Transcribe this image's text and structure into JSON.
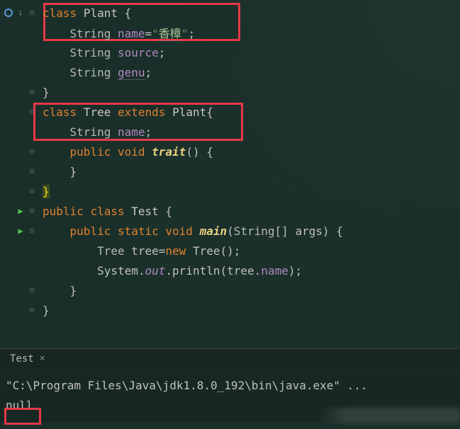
{
  "editor": {
    "plantClass": {
      "kw_class": "class",
      "name": "Plant",
      "lbrace": "{",
      "field1_type": "String",
      "field1_name": "name",
      "field1_eq": "=",
      "field1_quote1": "\"",
      "field1_val": "香樟",
      "field1_quote2": "\"",
      "field1_semi": ";",
      "field2_type": "String",
      "field2_name": "source",
      "field2_semi": ";",
      "field3_type": "String",
      "field3_name": "genu",
      "field3_semi": ";",
      "rbrace": "}"
    },
    "treeClass": {
      "kw_class": "class",
      "name": "Tree",
      "kw_extends": "extends",
      "super": "Plant",
      "lbrace": "{",
      "field1_type": "String",
      "field1_name": "name",
      "field1_semi": ";",
      "kw_public": "public",
      "kw_void": "void",
      "method": "trait",
      "parens": "()",
      "mlbrace": "{",
      "mrbrace": "}",
      "rbrace": "}"
    },
    "testClass": {
      "kw_public": "public",
      "kw_class": "class",
      "name": "Test",
      "lbrace": "{",
      "main_public": "public",
      "main_static": "static",
      "main_void": "void",
      "main_name": "main",
      "main_params_open": "(",
      "main_params_type": "String[]",
      "main_params_name": "args",
      "main_params_close": ")",
      "main_lbrace": "{",
      "stmt1_type": "Tree",
      "stmt1_var": "tree",
      "stmt1_eq": "=",
      "stmt1_new": "new",
      "stmt1_ctor": "Tree()",
      "stmt1_semi": ";",
      "stmt2_sys": "System",
      "stmt2_dot1": ".",
      "stmt2_out": "out",
      "stmt2_dot2": ".",
      "stmt2_println": "println",
      "stmt2_open": "(",
      "stmt2_arg1": "tree",
      "stmt2_dot3": ".",
      "stmt2_arg2": "name",
      "stmt2_close": ")",
      "stmt2_semi": ";",
      "main_rbrace": "}",
      "rbrace": "}"
    }
  },
  "tab": {
    "label": "Test",
    "close": "×"
  },
  "console": {
    "cmd": "\"C:\\Program Files\\Java\\jdk1.8.0_192\\bin\\java.exe\" ...",
    "output": "null"
  }
}
